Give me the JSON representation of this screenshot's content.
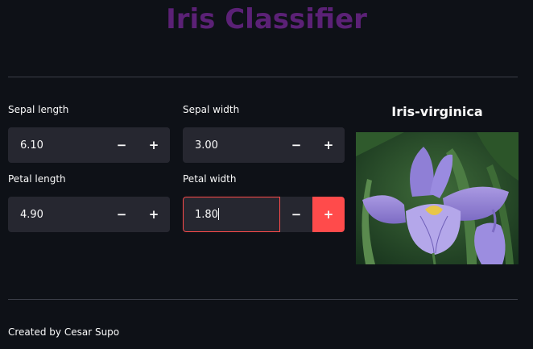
{
  "app": {
    "title": "Iris Classifier"
  },
  "inputs": [
    {
      "label": "Sepal length",
      "value": "6.10"
    },
    {
      "label": "Sepal width",
      "value": "3.00"
    },
    {
      "label": "Petal length",
      "value": "4.90"
    },
    {
      "label": "Petal width",
      "value": "1.80"
    }
  ],
  "stepper": {
    "minus": "−",
    "plus": "+"
  },
  "prediction": {
    "label": "Iris-virginica",
    "image": "iris-virginica-flower-photo"
  },
  "footer": {
    "text": "Created by Cesar Supo"
  },
  "colors": {
    "accent": "#ff4b4b",
    "title": "#5b2176",
    "background": "#0e1117",
    "input_bg": "#262730"
  }
}
